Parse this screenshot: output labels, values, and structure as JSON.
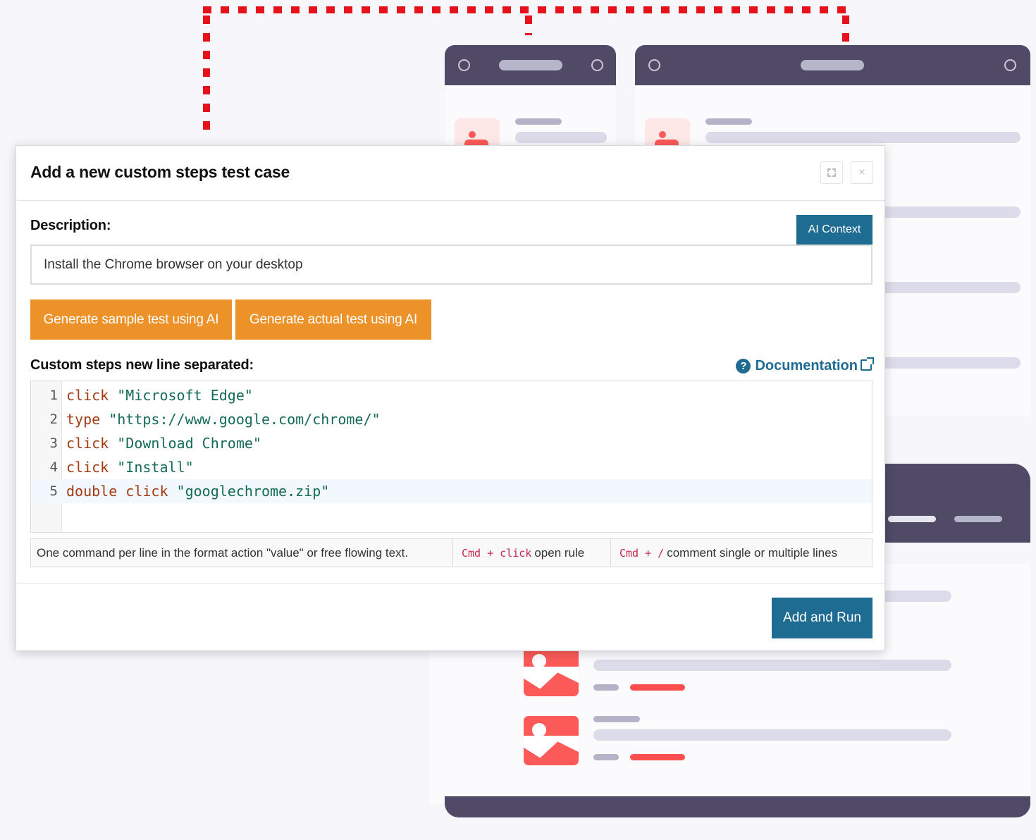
{
  "modal": {
    "title": "Add a new custom steps test case",
    "close_glyph": "×",
    "icons": {
      "expand": "expand-icon",
      "close": "close-icon",
      "help": "help-icon",
      "external": "external-link-icon"
    }
  },
  "description": {
    "label": "Description:",
    "ai_context_label": "AI Context",
    "value": "Install the Chrome browser on your desktop"
  },
  "actions": {
    "generate_sample_label": "Generate sample test using AI",
    "generate_actual_label": "Generate actual test using AI"
  },
  "steps": {
    "label": "Custom steps new line separated:",
    "doc_label": "Documentation",
    "help_glyph": "?",
    "lines": [
      {
        "n": "1",
        "action": "click",
        "value": "\"Microsoft Edge\""
      },
      {
        "n": "2",
        "action": "type",
        "value": "\"https://www.google.com/chrome/\""
      },
      {
        "n": "3",
        "action": "click",
        "value": "\"Download Chrome\""
      },
      {
        "n": "4",
        "action": "click",
        "value": "\"Install\""
      },
      {
        "n": "5",
        "action": "double click",
        "value": "\"googlechrome.zip\""
      }
    ]
  },
  "hints": {
    "format": "One command per line in the format action \"value\" or free flowing text.",
    "open_rule_keys": "Cmd + click",
    "open_rule_text": "open rule",
    "comment_keys": "Cmd + /",
    "comment_text": "comment single or multiple lines"
  },
  "footer": {
    "run_label": "Add and Run"
  },
  "colors": {
    "primary": "#1f6c93",
    "orange": "#ed9229",
    "illustration_dark": "#514a66",
    "illustration_red": "#fb4e4e",
    "dash_red": "#e6121b"
  }
}
